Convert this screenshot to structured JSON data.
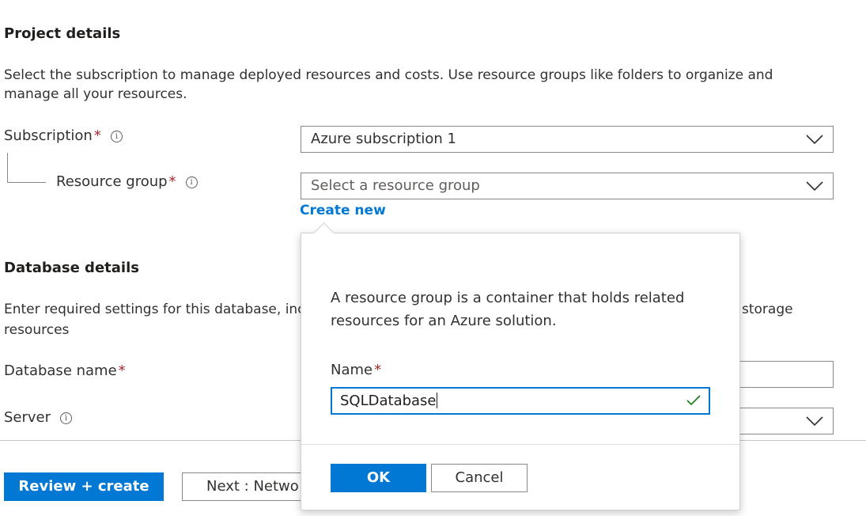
{
  "project_details": {
    "title": "Project details",
    "description": "Select the subscription to manage deployed resources and costs. Use resource groups like folders to organize and manage all your resources."
  },
  "subscription": {
    "label": "Subscription",
    "required_mark": "*",
    "info_icon": "info-icon",
    "value": "Azure subscription 1"
  },
  "resource_group": {
    "label": "Resource group",
    "required_mark": "*",
    "info_icon": "info-icon",
    "placeholder": "Select a resource group",
    "create_new_label": "Create new"
  },
  "database_details": {
    "title": "Database details",
    "description_visible_left": "Enter required settings for this database, inc",
    "description_visible_right": "storage",
    "description_line2": "resources"
  },
  "database_name": {
    "label": "Database name",
    "required_mark": "*"
  },
  "server": {
    "label": "Server",
    "info_icon": "info-icon"
  },
  "footer": {
    "review_create_label": "Review + create",
    "next_label": "Next : Netwo"
  },
  "callout": {
    "description": "A resource group is a container that holds related resources for an Azure solution.",
    "name_label": "Name",
    "name_required_mark": "*",
    "name_value": "SQLDatabase",
    "ok_label": "OK",
    "cancel_label": "Cancel",
    "valid_icon": "checkmark-icon"
  },
  "colors": {
    "accent": "#0078d4",
    "required": "#a4262c",
    "valid": "#107c10"
  }
}
